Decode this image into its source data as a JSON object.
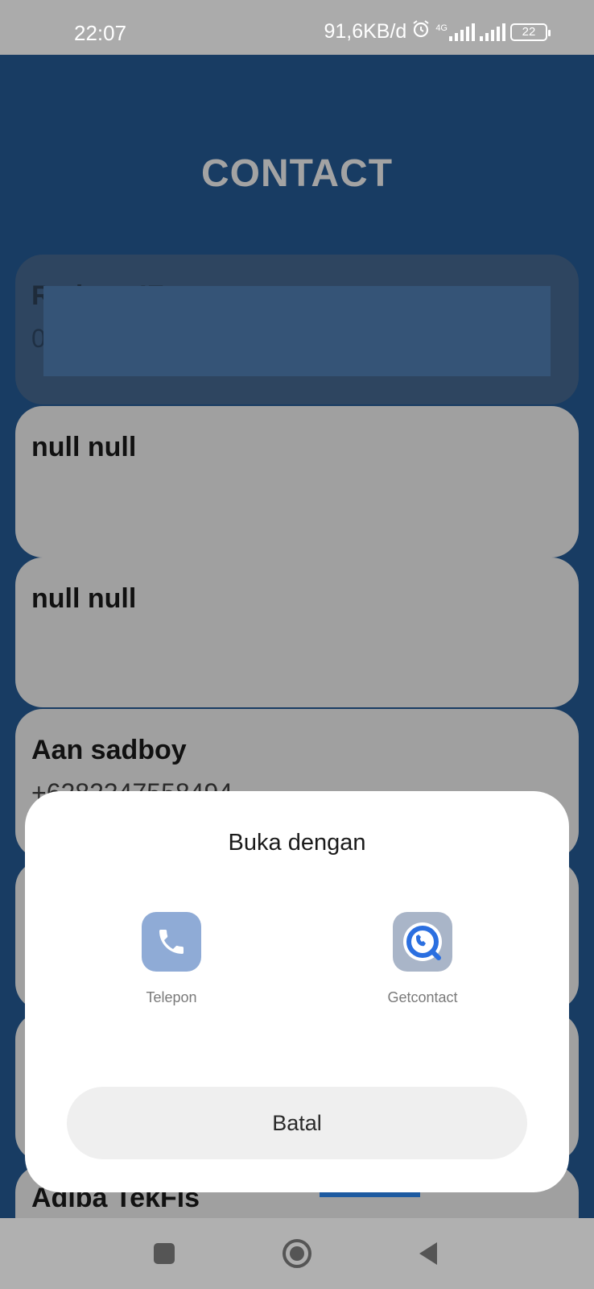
{
  "status_bar": {
    "time": "22:07",
    "net_speed": "91,6KB/d",
    "network_type": "4G",
    "battery": "22",
    "icons": [
      "alarm-icon",
      "signal-4g-icon",
      "signal-icon",
      "battery-icon"
    ]
  },
  "app": {
    "title": "CONTACT",
    "contacts": [
      {
        "name": "Redoqx IF",
        "phone": "0813-8224-6046"
      },
      {
        "name": "null null",
        "phone": ""
      },
      {
        "name": "null null",
        "phone": ""
      },
      {
        "name": "Aan sadboy",
        "phone": "+6282347558494"
      },
      {
        "name": "",
        "phone": ""
      },
      {
        "name": "",
        "phone": ""
      },
      {
        "name": "Adiba TekFis",
        "phone": ""
      }
    ]
  },
  "dialog": {
    "title": "Buka dengan",
    "options": [
      {
        "label": "Telepon",
        "icon": "phone-icon",
        "color": "#8fabd6"
      },
      {
        "label": "Getcontact",
        "icon": "getcontact-icon",
        "color": "#a9b5c8"
      }
    ],
    "cancel_label": "Batal"
  },
  "nav_bar": {
    "icons": [
      "recents-icon",
      "home-icon",
      "back-icon"
    ]
  },
  "colors": {
    "background": "#183c63",
    "card": "#a0a0a0",
    "dialog": "#ffffff",
    "cancel_button": "#efefef"
  }
}
